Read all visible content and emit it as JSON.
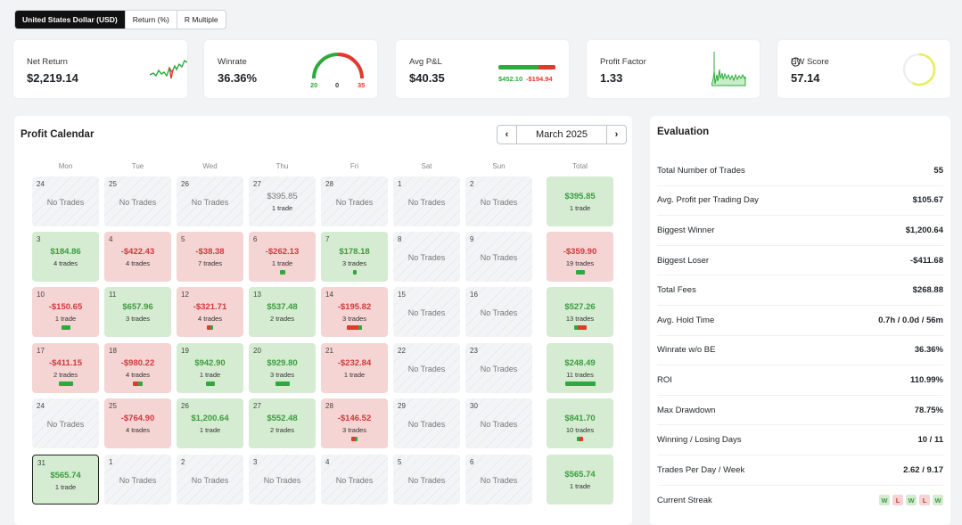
{
  "tabs": [
    "United States Dollar (USD)",
    "Return (%)",
    "R Multiple"
  ],
  "cards": {
    "net_return": {
      "label": "Net Return",
      "value": "$2,219.14"
    },
    "winrate": {
      "label": "Winrate",
      "value": "36.36%",
      "win": "20",
      "be": "0",
      "loss": "35"
    },
    "avg_pnl": {
      "label": "Avg P&L",
      "value": "$40.35",
      "avg_win": "$452.10",
      "avg_loss": "-$194.94"
    },
    "profit_factor": {
      "label": "Profit Factor",
      "value": "1.33"
    },
    "ew_score": {
      "label": "EW Score",
      "value": "57.14"
    }
  },
  "calendar": {
    "title": "Profit Calendar",
    "month": "March 2025",
    "days_of_week": [
      "Mon",
      "Tue",
      "Wed",
      "Thu",
      "Fri",
      "Sat",
      "Sun",
      "Total"
    ],
    "weeks": [
      [
        {
          "d": "24",
          "t": "none",
          "a": "No Trades"
        },
        {
          "d": "25",
          "t": "none",
          "a": "No Trades"
        },
        {
          "d": "26",
          "t": "none",
          "a": "No Trades"
        },
        {
          "d": "27",
          "t": "muted",
          "a": "$395.85",
          "n": "1 trade"
        },
        {
          "d": "28",
          "t": "none",
          "a": "No Trades"
        },
        {
          "d": "1",
          "t": "none",
          "a": "No Trades"
        },
        {
          "d": "2",
          "t": "none",
          "a": "No Trades"
        },
        {
          "d": "",
          "t": "g",
          "a": "$395.85",
          "n": "1 trade"
        }
      ],
      [
        {
          "d": "3",
          "t": "g",
          "a": "$184.86",
          "n": "4 trades"
        },
        {
          "d": "4",
          "t": "r",
          "a": "-$422.43",
          "n": "4 trades"
        },
        {
          "d": "5",
          "t": "r",
          "a": "-$38.38",
          "n": "7 trades"
        },
        {
          "d": "6",
          "t": "r",
          "a": "-$262.13",
          "n": "1 trade",
          "bar": [
            6,
            0
          ]
        },
        {
          "d": "7",
          "t": "g",
          "a": "$178.18",
          "n": "3 trades",
          "bar": [
            4,
            0
          ]
        },
        {
          "d": "8",
          "t": "none",
          "a": "No Trades"
        },
        {
          "d": "9",
          "t": "none",
          "a": "No Trades"
        },
        {
          "d": "",
          "t": "r",
          "a": "-$359.90",
          "n": "19 trades",
          "bar": [
            10,
            0
          ]
        }
      ],
      [
        {
          "d": "10",
          "t": "r",
          "a": "-$150.65",
          "n": "1 trade",
          "bar": [
            10,
            0
          ]
        },
        {
          "d": "11",
          "t": "g",
          "a": "$657.96",
          "n": "3 trades"
        },
        {
          "d": "12",
          "t": "r",
          "a": "-$321.71",
          "n": "4 trades",
          "bar": [
            3,
            4
          ]
        },
        {
          "d": "13",
          "t": "g",
          "a": "$537.48",
          "n": "2 trades"
        },
        {
          "d": "14",
          "t": "r",
          "a": "-$195.82",
          "n": "3 trades",
          "bar": [
            4,
            13
          ]
        },
        {
          "d": "15",
          "t": "none",
          "a": "No Trades"
        },
        {
          "d": "16",
          "t": "none",
          "a": "No Trades"
        },
        {
          "d": "",
          "t": "g",
          "a": "$527.26",
          "n": "13 trades",
          "bar": [
            4,
            10
          ]
        }
      ],
      [
        {
          "d": "17",
          "t": "r",
          "a": "-$411.15",
          "n": "2 trades",
          "bar": [
            16,
            0
          ]
        },
        {
          "d": "18",
          "t": "r",
          "a": "-$980.22",
          "n": "4 trades",
          "bar": [
            5,
            6
          ]
        },
        {
          "d": "19",
          "t": "g",
          "a": "$942.90",
          "n": "1 trade",
          "bar": [
            10,
            0
          ]
        },
        {
          "d": "20",
          "t": "g",
          "a": "$929.80",
          "n": "3 trades",
          "bar": [
            16,
            0
          ]
        },
        {
          "d": "21",
          "t": "r",
          "a": "-$232.84",
          "n": "1 trade"
        },
        {
          "d": "22",
          "t": "none",
          "a": "No Trades"
        },
        {
          "d": "23",
          "t": "none",
          "a": "No Trades"
        },
        {
          "d": "",
          "t": "g",
          "a": "$248.49",
          "n": "11 trades",
          "bar": [
            34,
            0
          ]
        }
      ],
      [
        {
          "d": "24",
          "t": "none",
          "a": "No Trades"
        },
        {
          "d": "25",
          "t": "r",
          "a": "-$764.90",
          "n": "4 trades"
        },
        {
          "d": "26",
          "t": "g",
          "a": "$1,200.64",
          "n": "1 trade"
        },
        {
          "d": "27",
          "t": "g",
          "a": "$552.48",
          "n": "2 trades"
        },
        {
          "d": "28",
          "t": "r",
          "a": "-$146.52",
          "n": "3 trades",
          "bar": [
            3,
            4
          ]
        },
        {
          "d": "29",
          "t": "none",
          "a": "No Trades"
        },
        {
          "d": "30",
          "t": "none",
          "a": "No Trades"
        },
        {
          "d": "",
          "t": "g",
          "a": "$841.70",
          "n": "10 trades",
          "bar": [
            3,
            4
          ]
        }
      ],
      [
        {
          "d": "31",
          "t": "g",
          "a": "$565.74",
          "n": "1 trade",
          "sel": true
        },
        {
          "d": "1",
          "t": "none",
          "a": "No Trades"
        },
        {
          "d": "2",
          "t": "none",
          "a": "No Trades"
        },
        {
          "d": "3",
          "t": "none",
          "a": "No Trades"
        },
        {
          "d": "4",
          "t": "none",
          "a": "No Trades"
        },
        {
          "d": "5",
          "t": "none",
          "a": "No Trades"
        },
        {
          "d": "6",
          "t": "none",
          "a": "No Trades"
        },
        {
          "d": "",
          "t": "g",
          "a": "$565.74",
          "n": "1 trade"
        }
      ]
    ]
  },
  "evaluation": {
    "title": "Evaluation",
    "rows": [
      {
        "label": "Total Number of Trades",
        "value": "55"
      },
      {
        "label": "Avg. Profit per Trading Day",
        "value": "$105.67"
      },
      {
        "label": "Biggest Winner",
        "value": "$1,200.64"
      },
      {
        "label": "Biggest Loser",
        "value": "-$411.68"
      },
      {
        "label": "Total Fees",
        "value": "$268.88"
      },
      {
        "label": "Avg. Hold Time",
        "value": "0.7h / 0.0d / 56m"
      },
      {
        "label": "Winrate w/o BE",
        "value": "36.36%"
      },
      {
        "label": "ROI",
        "value": "110.99%"
      },
      {
        "label": "Max Drawdown",
        "value": "78.75%"
      },
      {
        "label": "Winning / Losing Days",
        "value": "10 / 11"
      },
      {
        "label": "Trades Per Day / Week",
        "value": "2.62 / 9.17"
      },
      {
        "label": "Current Streak",
        "streak": [
          "W",
          "L",
          "W",
          "L",
          "W"
        ]
      }
    ]
  },
  "colors": {
    "green": "#3a9d3e",
    "red": "#d03a3a",
    "bar_green": "#2eaa3c",
    "bar_red": "#e03a2e",
    "gauge_yellow": "#e6ee5a"
  }
}
